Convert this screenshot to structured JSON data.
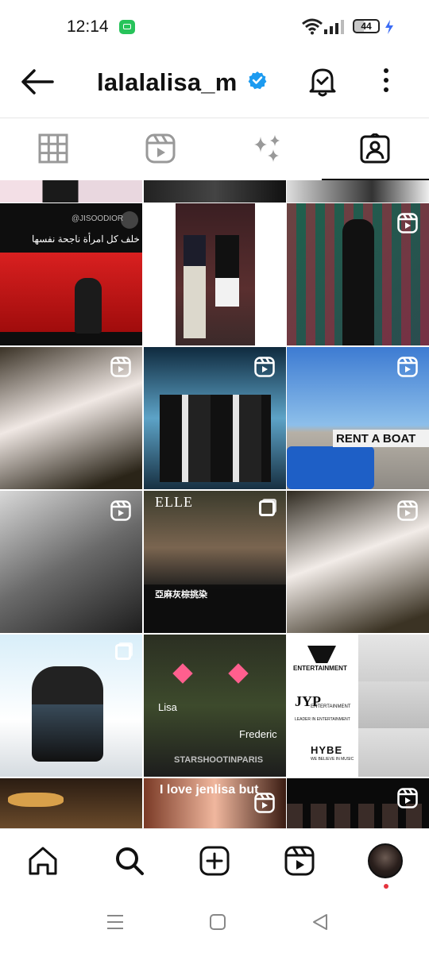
{
  "status_bar": {
    "time": "12:14",
    "battery": "44"
  },
  "profile": {
    "username": "lalalalisa_m"
  },
  "tabs": [
    "posts-grid",
    "reels",
    "effects",
    "tagged"
  ],
  "grid": {
    "cell_texts": {
      "arabic_handle": "@JISOODIOR",
      "arabic_caption": "خلف كل امرأة ناجحة نفسها",
      "elle_logo": "ELLE",
      "chinese_title": "亞麻灰棕挑染",
      "rent_a_boat": "RENT A BOAT",
      "lisa_label": "Lisa",
      "frederic_label": "Frederic",
      "watermark": "STARSHOOTINPARIS",
      "yg_label": "ENTERTAINMENT",
      "jyp_logo": "JYP",
      "jyp_label": "ENTERTAINMENT",
      "jyp_sub": "LEADER IN ENTERTAINMENT",
      "hybe_label": "HYBE",
      "hybe_sub": "WE BELIEVE IN MUSIC",
      "jenlisa_caption": "I love jenlisa but"
    }
  },
  "colors": {
    "verified": "#1d9bf0",
    "notification_dot": "#e5333d"
  }
}
